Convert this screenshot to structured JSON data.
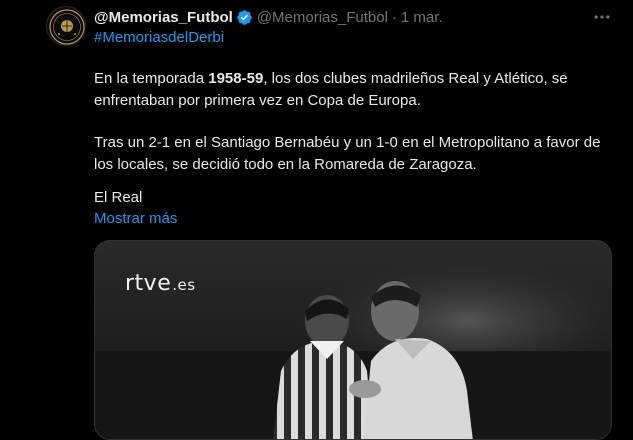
{
  "tweet": {
    "display_name": "@Memorias_Futbol",
    "handle": "@Memorias_Futbol",
    "separator": "·",
    "date": "1 mar.",
    "hashtag": "#MemoriasdelDerbi",
    "p1_a": "En la temporada ",
    "p1_bold": "1958-59",
    "p1_b": ", los dos clubes madrileños Real y Atlético, se enfrentaban por primera vez en Copa de Europa.",
    "p2": "Tras un 2-1 en el Santiago Bernabéu y un 1-0 en el Metropolitano a favor de los locales, se decidió todo en la Romareda de Zaragoza.",
    "p3": "El Real",
    "show_more": "Mostrar más"
  },
  "media": {
    "logo_main": "rtve",
    "logo_suffix": ".es"
  },
  "icons": {
    "verified": "verified-badge-icon",
    "more": "more-horizontal-icon",
    "avatar": "club-crest-icon"
  },
  "colors": {
    "background": "#000000",
    "text": "#e7e9ea",
    "secondary": "#71767b",
    "link": "#1d9bf0"
  }
}
